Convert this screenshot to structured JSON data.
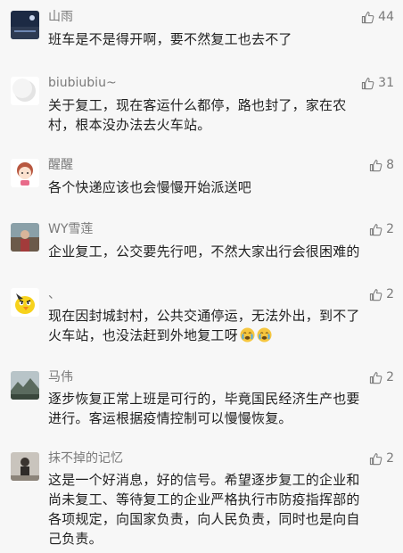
{
  "comments": [
    {
      "name": "山雨",
      "likes": "44",
      "lines": [
        "班车是不是得开啊，要不然复工也去不了"
      ],
      "avatar": "night-landscape-avatar"
    },
    {
      "name": "biubiubiu~",
      "likes": "31",
      "lines": [
        "关于复工，现在客运什么都停，路也封了，家在农",
        "村，根本没办法去火车站。"
      ],
      "avatar": "moon-avatar"
    },
    {
      "name": "醒醒",
      "likes": "8",
      "lines": [
        "各个快递应该也会慢慢开始派送吧"
      ],
      "avatar": "cartoon-girl-avatar"
    },
    {
      "name": "WY雪莲",
      "likes": "2",
      "lines": [
        "企业复工，公交要先行吧，不然大家出行会很困难的"
      ],
      "avatar": "photo-avatar"
    },
    {
      "name": "、",
      "likes": "2",
      "lines": [
        "现在因封城封村，公共交通停运，无法外出，到不了",
        "火车站，也没法赶到外地复工呀"
      ],
      "avatar": "angry-bird-avatar",
      "emojis": [
        "crying-face-emoji",
        "crying-face-emoji"
      ]
    },
    {
      "name": "马伟",
      "likes": "2",
      "lines": [
        "逐步恢复正常上班是可行的，毕竟国民经济生产也要",
        "进行。客运根据疫情控制可以慢慢恢复。"
      ],
      "avatar": "landscape-avatar"
    },
    {
      "name": "抹不掉的记忆",
      "likes": "2",
      "lines": [
        "这是一个好消息，好的信号。希望逐步复工的企业和",
        "尚未复工、等待复工的企业严格执行市防疫指挥部的",
        "各项规定，向国家负责，向人民负责，同时也是向自",
        "己负责。"
      ],
      "avatar": "person-avatar"
    }
  ],
  "colors": {
    "text": "#1f1f1f",
    "meta": "#7a7a7a",
    "background": "#f7f7f7"
  }
}
